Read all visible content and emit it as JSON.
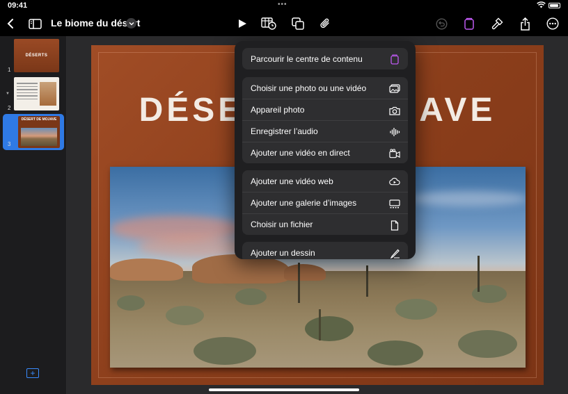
{
  "status_bar": {
    "time": "09:41",
    "center_dots": "•••"
  },
  "toolbar": {
    "document_title": "Le biome du désert",
    "icons": [
      "chevron-left-icon",
      "sidebar-icon",
      "chevron-down-icon",
      "play-icon",
      "table-clock-icon",
      "shapes-icon",
      "paperclip-icon",
      "undo-icon",
      "format-brush-icon",
      "share-icon",
      "more-icon"
    ],
    "accent_color": "#bf5af2"
  },
  "navigator": {
    "slides": [
      {
        "number": "1",
        "thumb_title": "DÉSERTS"
      },
      {
        "number": "2"
      },
      {
        "number": "3",
        "thumb_title": "DÉSERT DE MOJAVE",
        "selected": true
      }
    ],
    "add_slide_icon": "plus-square-icon",
    "selection_color": "#2f7ae5"
  },
  "slide": {
    "title_left": "DÉSE",
    "title_right": "AVE"
  },
  "insert_menu": {
    "groups": [
      {
        "items": [
          {
            "label": "Parcourir le centre de contenu",
            "icon": "content-hub-icon"
          }
        ]
      },
      {
        "items": [
          {
            "label": "Choisir une photo ou une vidéo",
            "icon": "photo-icon"
          },
          {
            "label": "Appareil photo",
            "icon": "camera-icon"
          },
          {
            "label": "Enregistrer l’audio",
            "icon": "waveform-icon"
          },
          {
            "label": "Ajouter une vidéo en direct",
            "icon": "live-video-icon"
          }
        ]
      },
      {
        "items": [
          {
            "label": "Ajouter une vidéo web",
            "icon": "cloud-play-icon"
          },
          {
            "label": "Ajouter une galerie d’images",
            "icon": "gallery-icon"
          },
          {
            "label": "Choisir un fichier",
            "icon": "document-icon"
          }
        ]
      },
      {
        "items": [
          {
            "label": "Ajouter un dessin",
            "icon": "pencil-draw-icon"
          }
        ]
      }
    ]
  }
}
